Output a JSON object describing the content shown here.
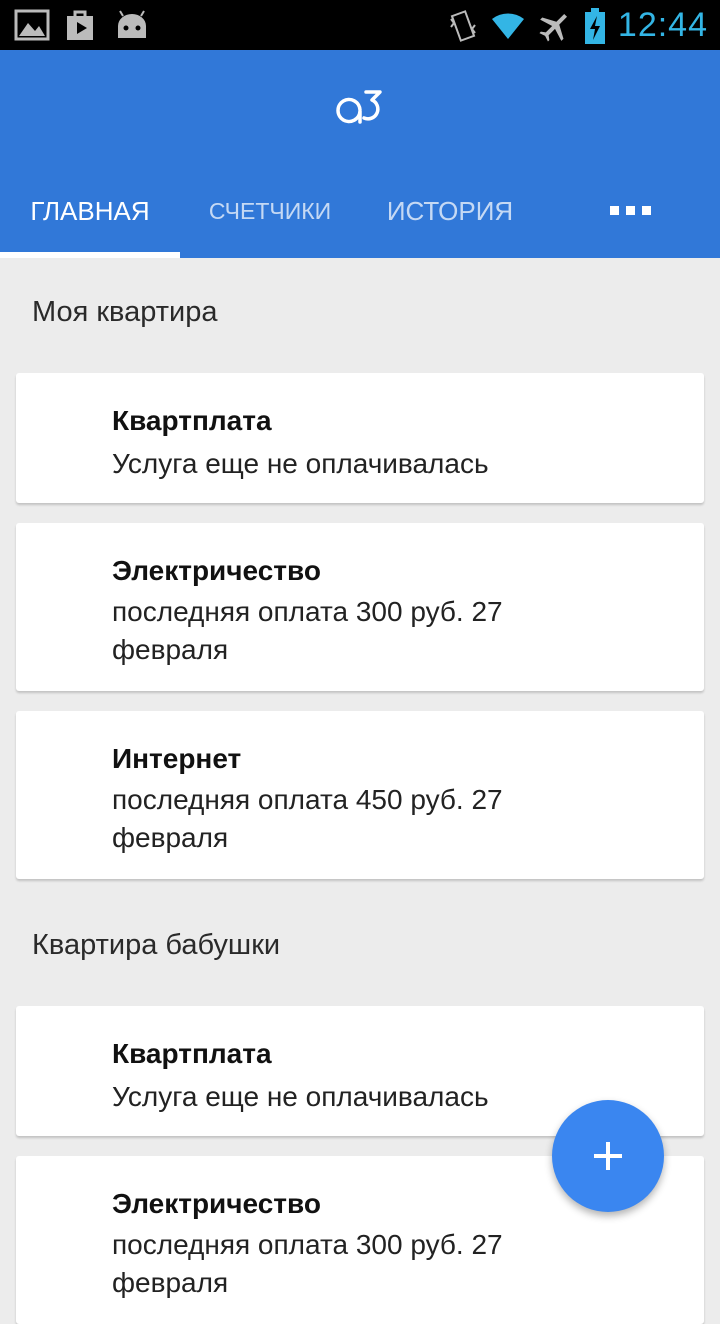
{
  "status_bar": {
    "time": "12:44",
    "left_icons": [
      "gallery-icon",
      "play-store-icon",
      "android-icon"
    ],
    "right_icons": [
      "vibrate-icon",
      "wifi-icon",
      "airplane-icon",
      "battery-charging-icon"
    ]
  },
  "app": {
    "logo": "a3",
    "accent_color": "#3178d8"
  },
  "tabs": [
    {
      "label": "ГЛАВНАЯ",
      "active": true
    },
    {
      "label": "СЧЕТЧИКИ",
      "active": false
    },
    {
      "label": "ИСТОРИЯ",
      "active": false
    }
  ],
  "more_menu_icon": "more-horizontal-icon",
  "sections": [
    {
      "title": "Моя квартира",
      "items": [
        {
          "title": "Квартплата",
          "subtitle": "Услуга еще не оплачивалась"
        },
        {
          "title": "Электричество",
          "subtitle": "последняя оплата 300 руб. 27 февраля"
        },
        {
          "title": "Интернет",
          "subtitle": "последняя оплата 450 руб. 27 февраля"
        }
      ]
    },
    {
      "title": "Квартира бабушки",
      "items": [
        {
          "title": "Квартплата",
          "subtitle": "Услуга еще не оплачивалась"
        },
        {
          "title": "Электричество",
          "subtitle": "последняя оплата 300 руб. 27 февраля"
        }
      ]
    }
  ],
  "fab": {
    "icon": "plus-icon"
  }
}
